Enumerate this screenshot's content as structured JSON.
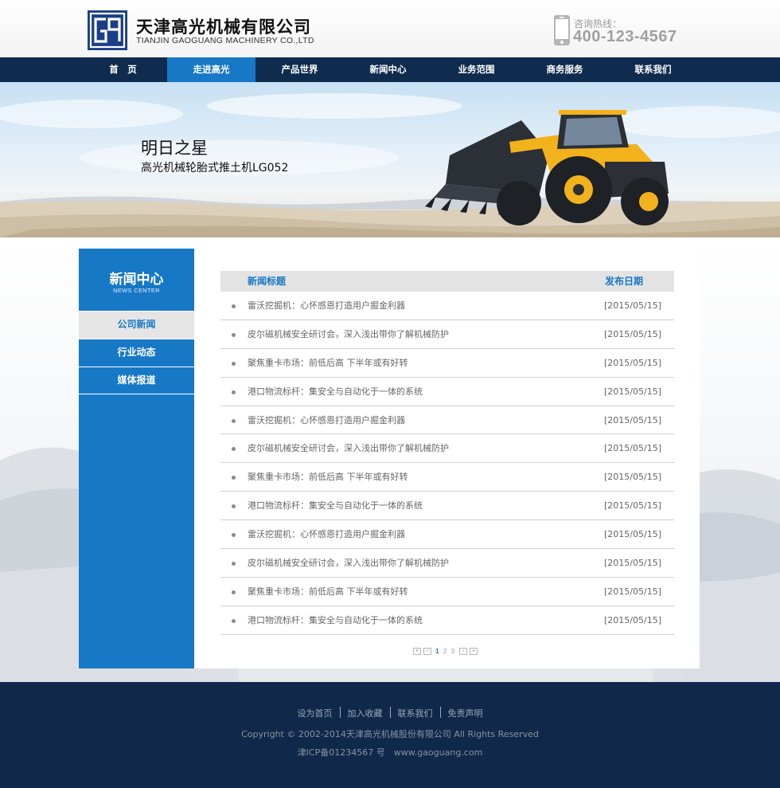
{
  "brand": {
    "logo_icon": "gg-monogram-logo",
    "name_cn": "天津高光机械有限公司",
    "name_en": "TIANJIN GAOGUANG MACHINERY CO.,LTD",
    "color": "#1b3f86"
  },
  "hotline": {
    "icon": "mobile-phone-icon",
    "label": "咨询热线：",
    "number": "400-123-4567"
  },
  "nav": {
    "items": [
      {
        "label": "首　页"
      },
      {
        "label": "走进高光"
      },
      {
        "label": "产品世界"
      },
      {
        "label": "新闻中心"
      },
      {
        "label": "业务范围"
      },
      {
        "label": "商务服务"
      },
      {
        "label": "联系我们"
      }
    ],
    "active_label": "走进高光",
    "bg_color": "#0f2c4f",
    "active_color": "#1778c6"
  },
  "banner": {
    "title": "明日之星",
    "subtitle": "高光机械轮胎式推土机LG052",
    "image": "wheel-loader-photo"
  },
  "sidebar": {
    "title": "新闻中心",
    "subtitle": "NEWS CENTER",
    "items": [
      {
        "label": "公司新闻"
      },
      {
        "label": "行业动态"
      },
      {
        "label": "媒体报道"
      }
    ],
    "active_label": "公司新闻",
    "color": "#1778c6"
  },
  "news": {
    "col_title": "新闻标题",
    "col_date": "发布日期",
    "rows": [
      {
        "title": "雷沃挖掘机：心怀感恩打造用户掘金利器",
        "date": "[2015/05/15]"
      },
      {
        "title": "皮尔磁机械安全研讨会，深入浅出带你了解机械防护",
        "date": "[2015/05/15]"
      },
      {
        "title": "聚焦重卡市场：前低后高 下半年或有好转",
        "date": "[2015/05/15]"
      },
      {
        "title": "港口物流标杆：集安全与自动化于一体的系统",
        "date": "[2015/05/15]"
      },
      {
        "title": "雷沃挖掘机：心怀感恩打造用户掘金利器",
        "date": "[2015/05/15]"
      },
      {
        "title": "皮尔磁机械安全研讨会，深入浅出带你了解机械防护",
        "date": "[2015/05/15]"
      },
      {
        "title": "聚焦重卡市场：前低后高 下半年或有好转",
        "date": "[2015/05/15]"
      },
      {
        "title": "港口物流标杆：集安全与自动化于一体的系统",
        "date": "[2015/05/15]"
      },
      {
        "title": "雷沃挖掘机：心怀感恩打造用户掘金利器",
        "date": "[2015/05/15]"
      },
      {
        "title": "皮尔磁机械安全研讨会，深入浅出带你了解机械防护",
        "date": "[2015/05/15]"
      },
      {
        "title": "聚焦重卡市场：前低后高 下半年或有好转",
        "date": "[2015/05/15]"
      },
      {
        "title": "港口物流标杆：集安全与自动化于一体的系统",
        "date": "[2015/05/15]"
      }
    ]
  },
  "pagination": {
    "first_icon": "first-page-icon",
    "prev_icon": "prev-page-icon",
    "next_icon": "next-page-icon",
    "last_icon": "last-page-icon",
    "pages": [
      "1",
      "2",
      "3"
    ],
    "current": "1"
  },
  "footer": {
    "links": [
      {
        "label": "设为首页"
      },
      {
        "label": "加入收藏"
      },
      {
        "label": "联系我们"
      },
      {
        "label": "免责声明"
      }
    ],
    "copyright": "Copyright © 2002-2014天津高光机械股份有限公司 All Rights Reserved",
    "icp": "津ICP备01234567 号　www.gaoguang.com",
    "bg_color": "#10294a"
  }
}
